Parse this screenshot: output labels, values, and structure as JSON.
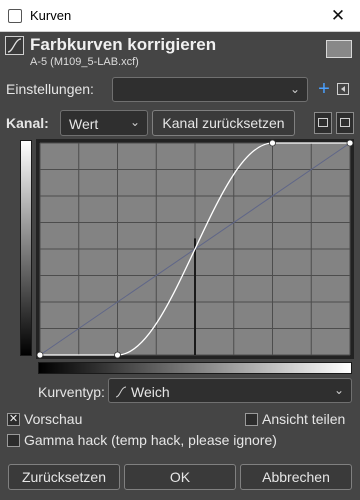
{
  "window": {
    "title": "Kurven",
    "close_glyph": "✕"
  },
  "header": {
    "title": "Farbkurven korrigieren",
    "subtitle": "A-5 (M109_5-LAB.xcf)"
  },
  "settings": {
    "label": "Einstellungen:",
    "value": ""
  },
  "channel": {
    "label": "Kanal:",
    "value": "Wert",
    "reset_label": "Kanal zurücksetzen"
  },
  "curve": {
    "grid_divisions": 8,
    "points": [
      [
        0,
        0
      ],
      [
        0.25,
        0
      ],
      [
        0.75,
        1
      ],
      [
        1,
        1
      ]
    ],
    "histogram_spike": {
      "at": 0.5,
      "level": 0.55
    }
  },
  "curve_type": {
    "label": "Kurventyp:",
    "value": "Weich"
  },
  "preview": {
    "label": "Vorschau",
    "checked": true
  },
  "split": {
    "label": "Ansicht teilen",
    "checked": false
  },
  "gamma": {
    "label": "Gamma hack (temp hack, please ignore)",
    "checked": false
  },
  "buttons": {
    "reset": "Zurücksetzen",
    "ok": "OK",
    "cancel": "Abbrechen"
  },
  "icons": {
    "plus": "+",
    "arrow": "⌄",
    "check": "✕"
  }
}
